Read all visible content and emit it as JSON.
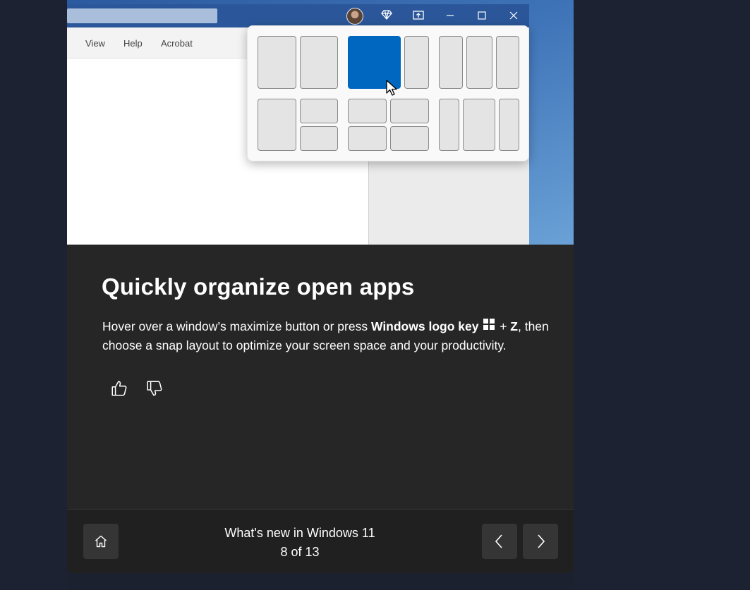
{
  "illustration": {
    "menu": [
      "View",
      "Help",
      "Acrobat"
    ],
    "titlebar_icons": [
      "profile-avatar",
      "diamond-icon",
      "share-icon",
      "minimize-icon",
      "maximize-icon",
      "close-icon"
    ],
    "snap_layout_accent": "#0067c0"
  },
  "tip": {
    "heading": "Quickly organize open apps",
    "desc_part1": "Hover over a window’s maximize button or press ",
    "desc_key": "Windows logo key",
    "desc_plus": " + ",
    "desc_z": "Z",
    "desc_part2": ", then choose a snap layout to optimize your screen space and your productivity."
  },
  "feedback": {
    "like_icon": "thumbs-up-icon",
    "dislike_icon": "thumbs-down-icon"
  },
  "footer": {
    "title": "What's new in Windows 11",
    "page": "8 of 13",
    "home_icon": "home-icon",
    "prev_icon": "chevron-left-icon",
    "next_icon": "chevron-right-icon"
  }
}
